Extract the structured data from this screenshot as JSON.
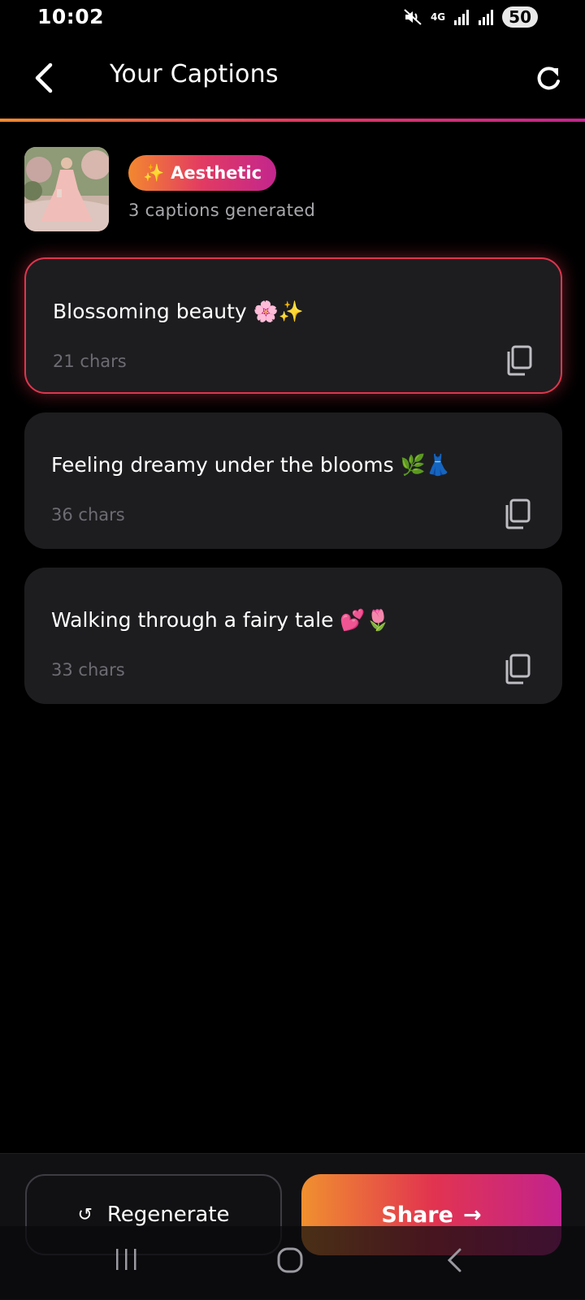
{
  "status_bar": {
    "time": "10:02",
    "network": "4G",
    "battery": "50",
    "icons": [
      "mute-icon",
      "network-4g-icon",
      "signal-icon",
      "signal-icon",
      "battery-icon"
    ]
  },
  "header": {
    "title": "Your Captions",
    "back_icon": "chevron-left-icon",
    "refresh_icon": "refresh-icon"
  },
  "summary": {
    "tone_emoji": "✨",
    "tone": "Aesthetic",
    "count_text": "3 captions generated"
  },
  "captions": [
    {
      "text": "Blossoming beauty 🌸✨",
      "chars": "21 chars",
      "selected": true
    },
    {
      "text": "Feeling dreamy under the blooms 🌿👗",
      "chars": "36 chars",
      "selected": false
    },
    {
      "text": "Walking through a fairy tale 💕🌷",
      "chars": "33 chars",
      "selected": false
    }
  ],
  "actions": {
    "regenerate_icon": "↺",
    "regenerate": "Regenerate",
    "share": "Share",
    "share_icon": "→"
  },
  "colors": {
    "accent_orange": "#f28a2e",
    "accent_red": "#e23a5f",
    "accent_magenta": "#c3258d",
    "card_bg": "#1d1d20",
    "selected_border": "#e0354d"
  }
}
